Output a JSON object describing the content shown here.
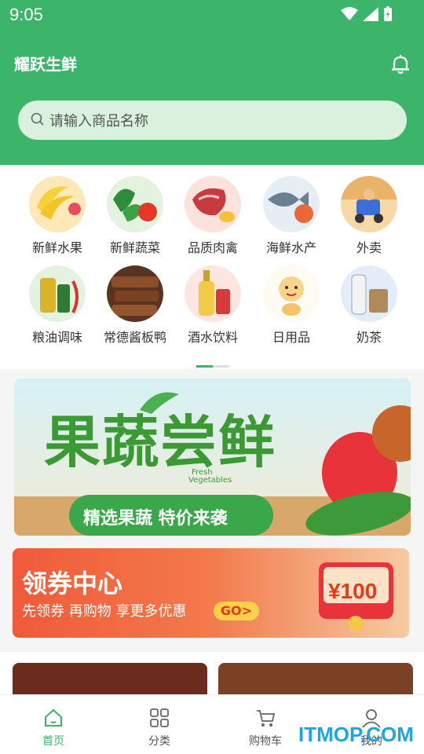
{
  "status": {
    "time": "9:05"
  },
  "header": {
    "title": "耀跃生鲜"
  },
  "search": {
    "placeholder": "请输入商品名称"
  },
  "categories": [
    {
      "label": "新鲜水果",
      "icon": "banana-icon"
    },
    {
      "label": "新鲜蔬菜",
      "icon": "vegetable-icon"
    },
    {
      "label": "品质肉禽",
      "icon": "meat-icon"
    },
    {
      "label": "海鲜水产",
      "icon": "fish-icon"
    },
    {
      "label": "外卖",
      "icon": "delivery-icon"
    },
    {
      "label": "粮油调味",
      "icon": "oil-icon"
    },
    {
      "label": "常德酱板鸭",
      "icon": "duck-icon"
    },
    {
      "label": "酒水饮料",
      "icon": "drink-icon"
    },
    {
      "label": "日用品",
      "icon": "mascot-icon"
    },
    {
      "label": "奶茶",
      "icon": "milk-tea-icon"
    }
  ],
  "banner1": {
    "title": "果蔬尝鲜",
    "subtitle": "精选果蔬 特价来袭",
    "tag_line1": "Fresh",
    "tag_line2": "Vegetables"
  },
  "banner2": {
    "title": "领券中心",
    "subtitle": "先领券 再购物 享更多优惠",
    "go": "GO>",
    "amount": "¥100"
  },
  "nav": [
    {
      "label": "首页",
      "icon": "home-icon",
      "active": true
    },
    {
      "label": "分类",
      "icon": "grid-icon",
      "active": false
    },
    {
      "label": "购物车",
      "icon": "cart-icon",
      "active": false
    },
    {
      "label": "我的",
      "icon": "user-icon",
      "active": false
    }
  ],
  "watermark": "ITMOP.COM",
  "colors": {
    "brand": "#3cb56a",
    "search_bg": "#d9f1dd",
    "coupon_red": "#e53a1a"
  }
}
